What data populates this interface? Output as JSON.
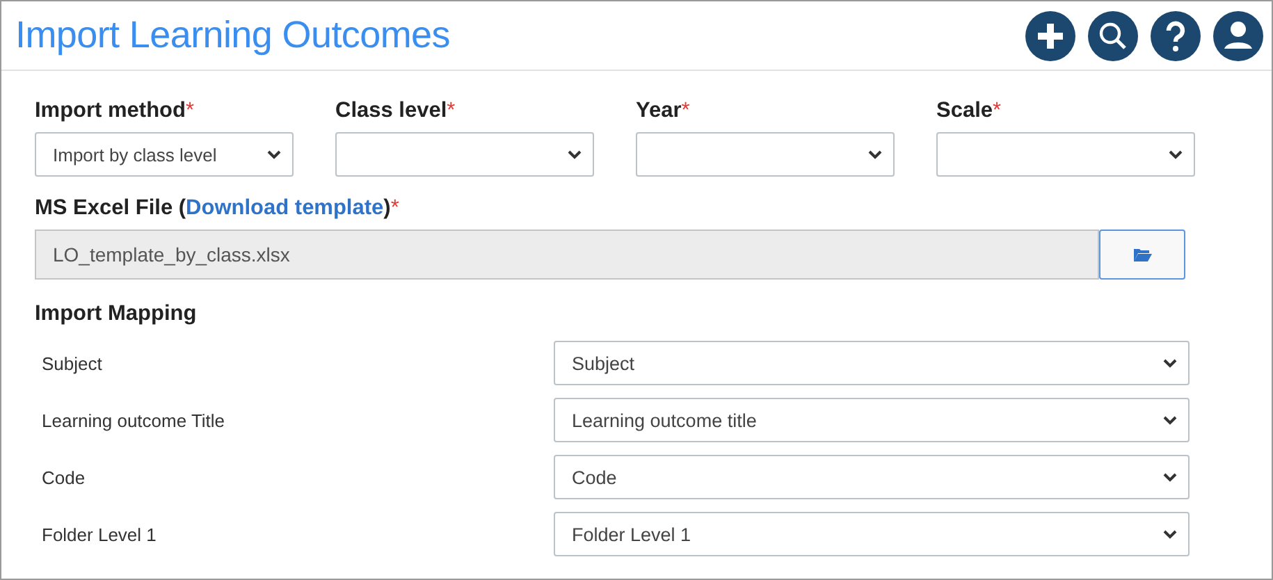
{
  "title": "Import Learning Outcomes",
  "filters": [
    {
      "label": "Import method",
      "asterisk": "*",
      "value": "Import by class level"
    },
    {
      "label": "Class level",
      "asterisk": "*"
    },
    {
      "label": "Year",
      "asterisk": "*"
    },
    {
      "label": "Scale",
      "asterisk": "*"
    }
  ],
  "file": {
    "label_before": "MS Excel File (",
    "link": "Download template",
    "label_after": ")",
    "asterisk": "*",
    "value": "LO_template_by_class.xlsx"
  },
  "mapping": {
    "heading": "Import Mapping",
    "rows": [
      {
        "label": "Subject",
        "value": "Subject"
      },
      {
        "label": "Learning outcome Title",
        "value": "Learning outcome title"
      },
      {
        "label": "Code",
        "value": "Code"
      },
      {
        "label": "Folder Level 1",
        "value": "Folder Level 1"
      }
    ]
  }
}
